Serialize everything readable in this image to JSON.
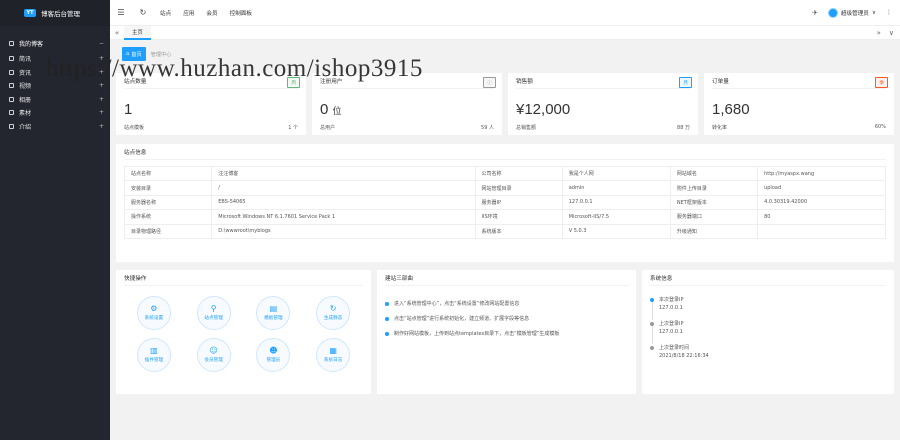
{
  "app": {
    "logo_mark": "YT",
    "title": "博客后台管理"
  },
  "sidebar": {
    "top": {
      "label": "我的博客",
      "toggle": "−"
    },
    "items": [
      {
        "label": "简讯",
        "toggle": "+"
      },
      {
        "label": "资讯",
        "toggle": "+"
      },
      {
        "label": "视频",
        "toggle": "+"
      },
      {
        "label": "相册",
        "toggle": "+"
      },
      {
        "label": "素材",
        "toggle": "+"
      },
      {
        "label": "介绍",
        "toggle": "+"
      }
    ]
  },
  "header": {
    "menu_icon": "☰",
    "refresh_icon": "↻",
    "nav": [
      "站点",
      "应用",
      "会员",
      "控制面板"
    ],
    "bell_icon": "✈",
    "user_name": "超级管理员",
    "user_caret": "∨",
    "more_icon": "⋮"
  },
  "tabs": {
    "left_arrow": "«",
    "home": "主页",
    "right_arrow": "»",
    "down_arrow": "∨"
  },
  "breadcrumb": {
    "button_icon": "⌂",
    "button": "首页",
    "path": "管理中心"
  },
  "stats": [
    {
      "title": "站点数量",
      "badge": "周",
      "badge_color": "#5fb878",
      "value": "1",
      "unit": "",
      "foot_label": "站点模板",
      "foot_value": "1 个"
    },
    {
      "title": "注册用户",
      "badge": "ⓘ",
      "badge_color": "#999999",
      "value": "0",
      "unit": "位",
      "foot_label": "总用户",
      "foot_value": "59 人"
    },
    {
      "title": "销售额",
      "badge": "月",
      "badge_color": "#1e9fff",
      "value": "¥12,000",
      "unit": "",
      "foot_label": "总销售额",
      "foot_value": "88 万"
    },
    {
      "title": "订单量",
      "badge": "季",
      "badge_color": "#ff5722",
      "value": "1,680",
      "unit": "",
      "foot_label": "转化率",
      "foot_value": "60%"
    }
  ],
  "site_info": {
    "title": "站点信息",
    "rows": [
      [
        "站点名称",
        "汪汪博客",
        "公司名称",
        "我是个人网",
        "网站域名",
        "http://myaspx.wang"
      ],
      [
        "安装目录",
        "/",
        "网站管理目录",
        "admin",
        "附件上传目录",
        "upload"
      ],
      [
        "服务器名称",
        "EBS-54065",
        "服务器IP",
        "127.0.0.1",
        "NET框架版本",
        "4.0.30319.42000"
      ],
      [
        "操作系统",
        "Microsoft Windows NT 6.1.7601 Service Pack 1",
        "IIS环境",
        "Microsoft-IIS/7.5",
        "服务器端口",
        "80"
      ],
      [
        "目录物理路径",
        "D:\\wwwroot\\myblogs",
        "系统版本",
        "V 5.0.3",
        "升级通知",
        ""
      ]
    ]
  },
  "quick": {
    "title": "快捷操作",
    "items": [
      {
        "icon": "⚙",
        "label": "系统设置"
      },
      {
        "icon": "⚲",
        "label": "站点管理"
      },
      {
        "icon": "▤",
        "label": "模板管理"
      },
      {
        "icon": "↻",
        "label": "生成静态"
      },
      {
        "icon": "▥",
        "label": "插件管理"
      },
      {
        "icon": "☺",
        "label": "会员管理"
      },
      {
        "icon": "☻",
        "label": "管理员"
      },
      {
        "icon": "▦",
        "label": "系统日志"
      }
    ]
  },
  "notes": {
    "title": "建站三部曲",
    "items": [
      "进入“系统管理中心”，点击“系统设置”修改网站配置信息",
      "点击“站点管理”进行系统初始化，建立频道、扩展字段等信息",
      "制作好网站模板，上传到站点templates目录下，点击“模板管理”生成模板"
    ]
  },
  "sys": {
    "title": "系统信息",
    "items": [
      {
        "label": "本次登录IP",
        "value": "127.0.0.1",
        "active": true
      },
      {
        "label": "上次登录IP",
        "value": "127.0.0.1",
        "active": false
      },
      {
        "label": "上次登录时间",
        "value": "2021/8/18 22:16:34",
        "active": false
      }
    ]
  },
  "watermark": "https://www.huzhan.com/ishop3915"
}
